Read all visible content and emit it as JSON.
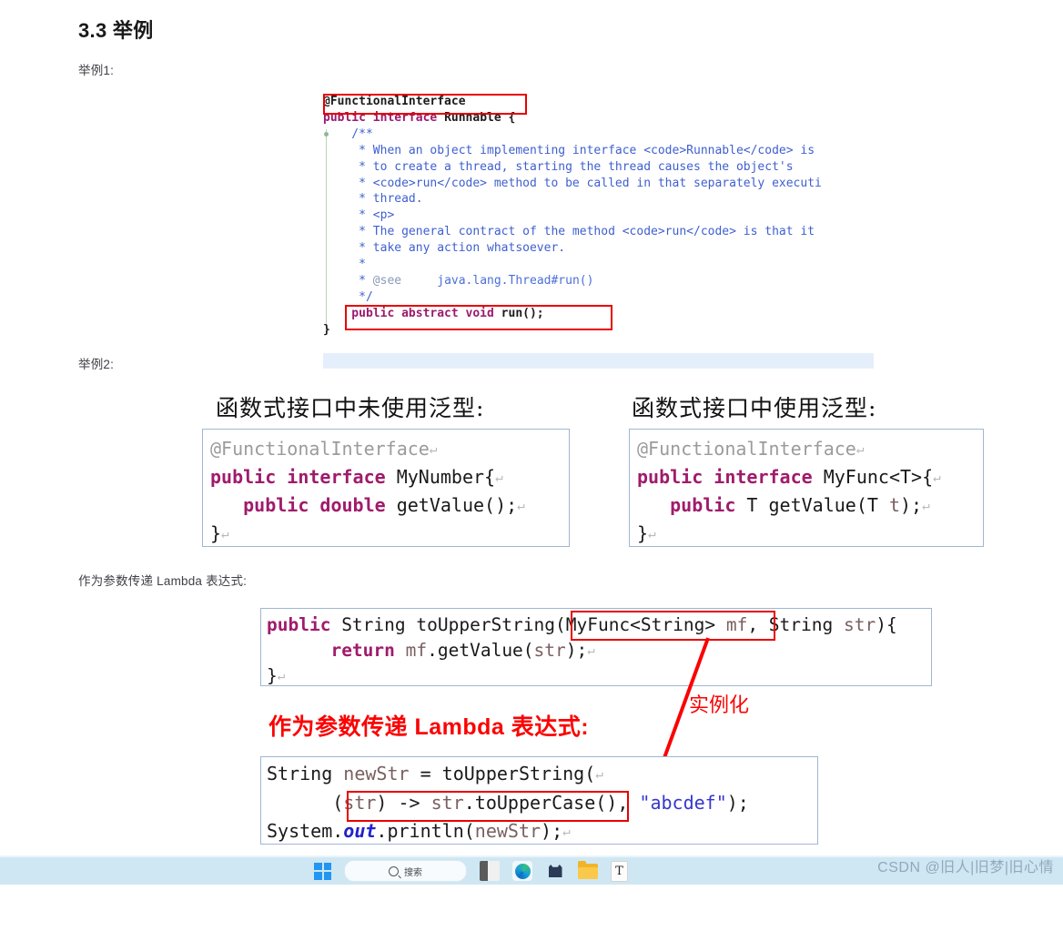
{
  "document": {
    "heading": "3.3 举例",
    "label_example1": "举例1:",
    "label_example2": "举例2:",
    "label_lambda_param": "作为参数传递 Lambda 表达式:"
  },
  "ide_block": {
    "lines": [
      {
        "segments": [
          {
            "text": "@FunctionalInterface",
            "style": "plain-bold"
          }
        ]
      },
      {
        "segments": [
          {
            "text": "public interface",
            "style": "keyword"
          },
          {
            "text": " Runnable {",
            "style": "plain-bold"
          }
        ]
      },
      {
        "segments": [
          {
            "text": "    /**",
            "style": "comment"
          }
        ]
      },
      {
        "segments": [
          {
            "text": "     * When an object implementing interface <code>Runnable</code> is",
            "style": "comment"
          }
        ]
      },
      {
        "segments": [
          {
            "text": "     * to create a thread, starting the thread causes the object's",
            "style": "comment"
          }
        ]
      },
      {
        "segments": [
          {
            "text": "     * <code>run</code> method to be called in that separately executi",
            "style": "comment"
          }
        ]
      },
      {
        "segments": [
          {
            "text": "     * thread.",
            "style": "comment"
          }
        ]
      },
      {
        "segments": [
          {
            "text": "     * <p>",
            "style": "comment"
          }
        ]
      },
      {
        "segments": [
          {
            "text": "     * The general contract of the method <code>run</code> is that it",
            "style": "comment"
          }
        ]
      },
      {
        "segments": [
          {
            "text": "     * take any action whatsoever.",
            "style": "comment"
          }
        ]
      },
      {
        "segments": [
          {
            "text": "     *",
            "style": "comment"
          }
        ]
      },
      {
        "segments": [
          {
            "text": "     * @see",
            "style": "comment-tag"
          },
          {
            "text": "     java.lang.Thread#run()",
            "style": "comment-link"
          }
        ]
      },
      {
        "segments": [
          {
            "text": "     */",
            "style": "comment"
          }
        ]
      },
      {
        "segments": [
          {
            "text": "    public abstract void",
            "style": "keyword"
          },
          {
            "text": " run();",
            "style": "plain-bold"
          }
        ]
      },
      {
        "segments": [
          {
            "text": "}",
            "style": "plain-bold"
          }
        ]
      }
    ],
    "highlight_boxes": [
      "@FunctionalInterface",
      "public abstract void run();"
    ],
    "colors": {
      "keyword": "#9b1b6e",
      "comment": "#3f5fd0",
      "plain": "#1c1c1c",
      "highlight_row": "#e5effb",
      "redbox": "#e80000"
    }
  },
  "example2": {
    "caption_left": "函数式接口中未使用泛型:",
    "caption_right": "函数式接口中使用泛型:",
    "box_left_lines": [
      "@FunctionalInterface",
      "public interface MyNumber{",
      "   public double getValue();",
      "}"
    ],
    "box_right_lines": [
      "@FunctionalInterface",
      "public interface MyFunc<T>{",
      "   public T getValue(T t);",
      "}"
    ]
  },
  "lambda_param_block": {
    "lines": [
      "public String toUpperString(MyFunc<String> mf, String str){",
      "     return mf.getValue(str);",
      "}"
    ],
    "highlight_box_text": "MyFunc<String> mf"
  },
  "annotation": {
    "red_heading": "作为参数传递 Lambda 表达式:",
    "arrow_label": "实例化",
    "arrow_color": "#fb0202"
  },
  "lambda_call_block": {
    "lines": [
      "String newStr = toUpperString(",
      "     (str) -> str.toUpperCase(), \"abcdef\");",
      "System.out.println(newStr);"
    ],
    "highlight_box_text": "(str) -> str.toUpperCase(),",
    "string_literal": "\"abcdef\""
  },
  "taskbar": {
    "search_placeholder": "搜索",
    "icons": [
      "windows-start-icon",
      "search-icon",
      "task-view-icon",
      "edge-browser-icon",
      "cat-app-icon",
      "file-explorer-icon",
      "text-editor-icon"
    ],
    "background": "#cfe7f3"
  },
  "watermark": {
    "text": "CSDN @旧人|旧梦|旧心情"
  }
}
